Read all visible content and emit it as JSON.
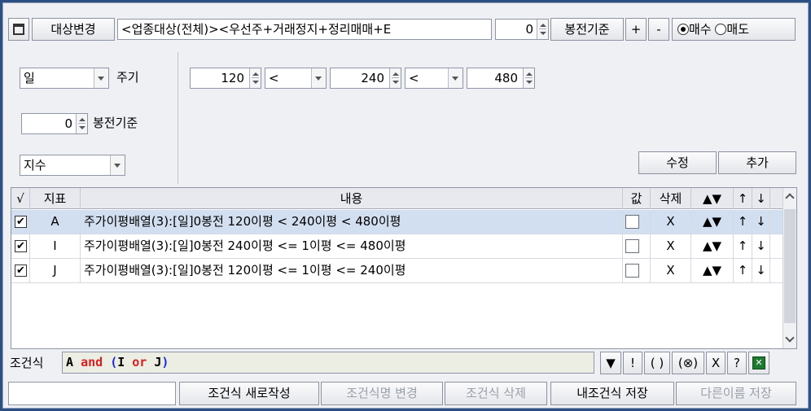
{
  "toolbar": {
    "change_target_label": "대상변경",
    "target_value": "<업종대상(전체)><우선주+거래정지+정리매매+E",
    "offset_value": "0",
    "offset_label": "봉전기준",
    "plus_label": "+",
    "minus_label": "-",
    "buy_label": "매수",
    "sell_label": "매도",
    "selected": "buy"
  },
  "settings": {
    "period_value": "일",
    "period_label": "주기",
    "offset_value": "0",
    "offset_label": "봉전기준",
    "type_value": "지수",
    "ma1": "120",
    "op1": "<",
    "ma2": "240",
    "op2": "<",
    "ma3": "480",
    "edit_label": "수정",
    "add_label": "추가"
  },
  "grid": {
    "headers": {
      "check": "√",
      "indicator": "지표",
      "content": "내용",
      "value": "값",
      "delete": "삭제",
      "up_down": "▲▼",
      "up": "↑",
      "down": "↓"
    },
    "rows": [
      {
        "checked": "✔",
        "id": "A",
        "content": "주가이평배열(3):[일]0봉전 120이평 < 240이평 < 480이평",
        "delete": "X",
        "updown": "▲▼",
        "up": "↑",
        "down": "↓"
      },
      {
        "checked": "✔",
        "id": "I",
        "content": "주가이평배열(3):[일]0봉전 240이평 <= 1이평 <= 480이평",
        "delete": "X",
        "updown": "▲▼",
        "up": "↑",
        "down": "↓"
      },
      {
        "checked": "✔",
        "id": "J",
        "content": "주가이평배열(3):[일]0봉전 120이평 <= 1이평 <= 240이평",
        "delete": "X",
        "updown": "▲▼",
        "up": "↑",
        "down": "↓"
      }
    ]
  },
  "expression": {
    "label": "조건식",
    "parts": [
      "A",
      "and",
      "(",
      "I",
      "or",
      "J",
      ")"
    ],
    "buttons": [
      "▼",
      "!",
      "( )",
      "(⊗)",
      "X",
      "?"
    ]
  },
  "bottom": {
    "name_value": "",
    "new_label": "조건식 새로작성",
    "rename_label": "조건식명 변경",
    "delete_label": "조건식 삭제",
    "save_label": "내조건식 저장",
    "save_as_label": "다른이름 저장"
  },
  "colors": {
    "accent_blue": "#1a2bd6",
    "accent_red": "#d42020",
    "excel_green": "#1e7a2e",
    "selected_row": "#d2dff0"
  }
}
